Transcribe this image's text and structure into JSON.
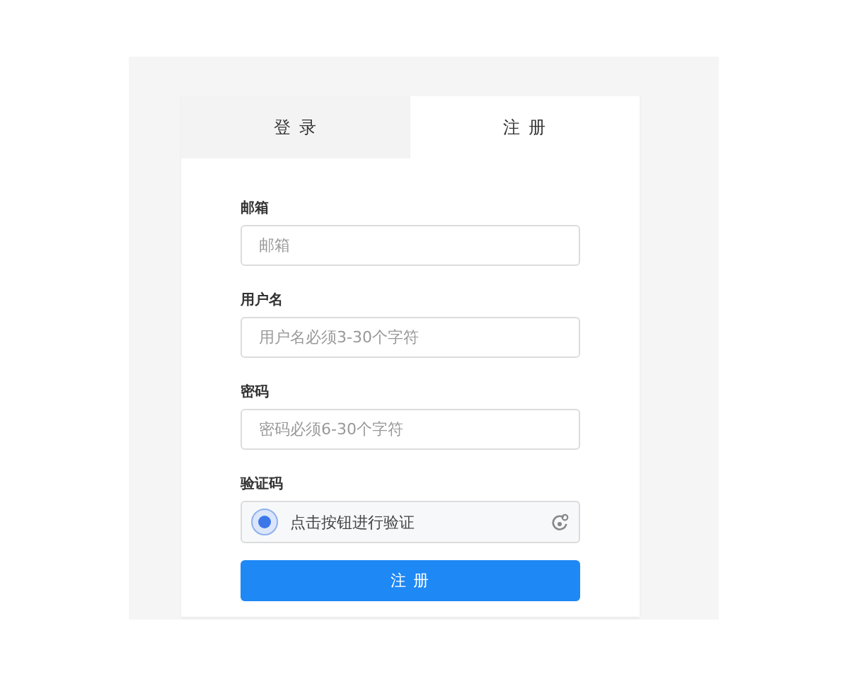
{
  "tabs": [
    {
      "label": "登 录",
      "selected": false
    },
    {
      "label": "注 册",
      "selected": true
    }
  ],
  "fields": [
    {
      "label": "邮箱",
      "placeholder": "邮箱"
    },
    {
      "label": "用户名",
      "placeholder": "用户名必须3-30个字符"
    },
    {
      "label": "密码",
      "placeholder": "密码必须6-30个字符"
    }
  ],
  "captcha": {
    "label": "验证码",
    "prompt": "点击按钮进行验证"
  },
  "submit": "注 册"
}
